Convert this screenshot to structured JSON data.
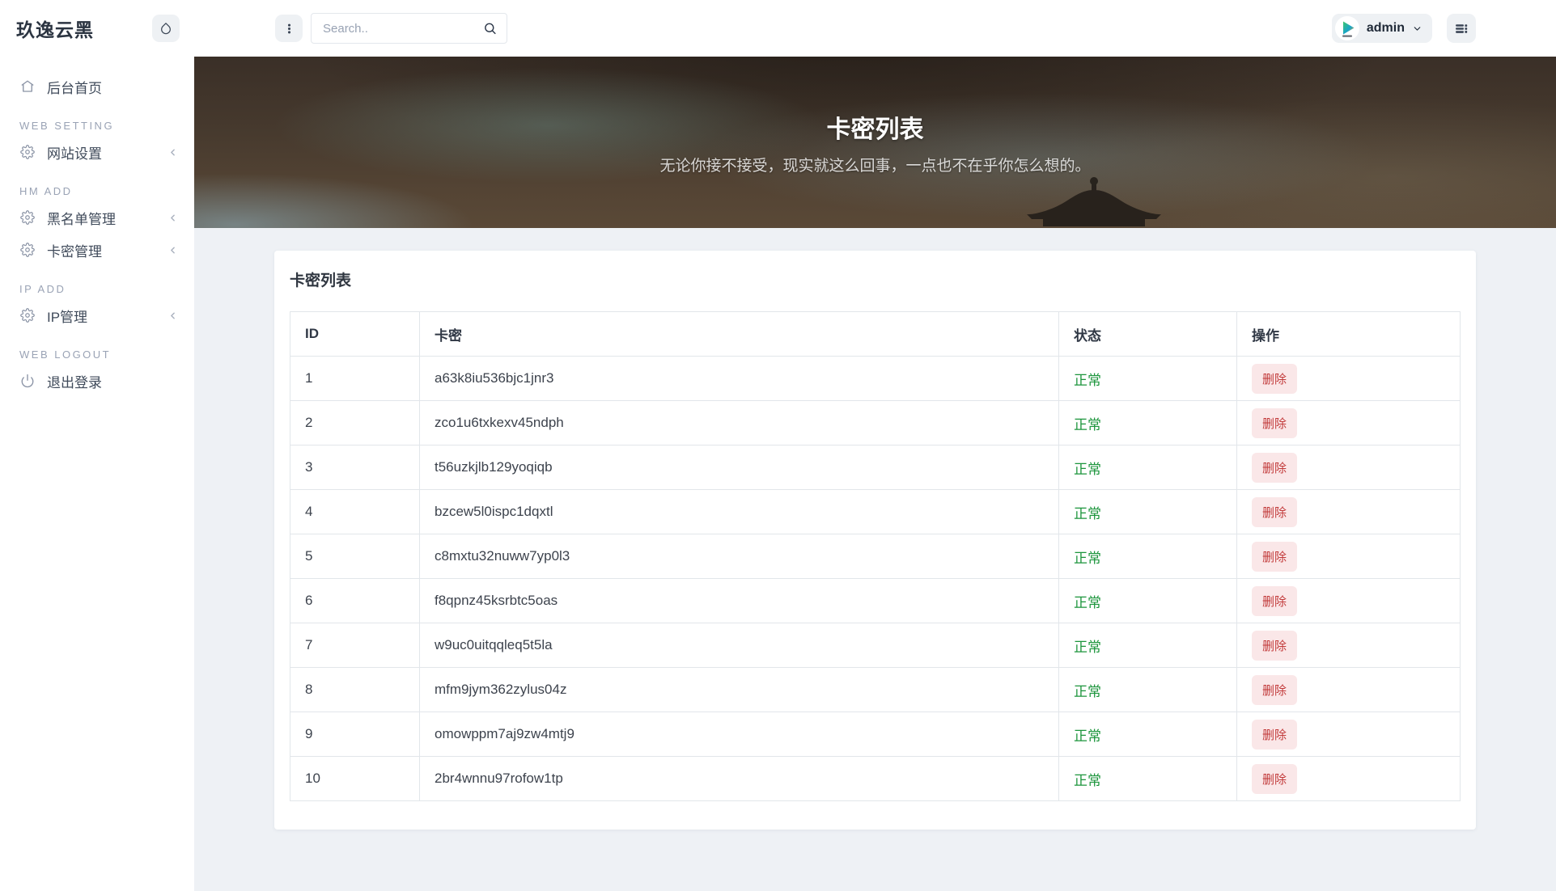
{
  "brand": "玖逸云黑",
  "topbar": {
    "search_placeholder": "Search..",
    "username": "admin"
  },
  "sidebar": {
    "items": [
      {
        "type": "link",
        "label": "后台首页",
        "icon": "home"
      },
      {
        "type": "section",
        "label": "WEB SETTING"
      },
      {
        "type": "link",
        "label": "网站设置",
        "icon": "gear",
        "expandable": true
      },
      {
        "type": "section",
        "label": "HM ADD"
      },
      {
        "type": "link",
        "label": "黑名单管理",
        "icon": "gear",
        "expandable": true
      },
      {
        "type": "link",
        "label": "卡密管理",
        "icon": "gear",
        "expandable": true
      },
      {
        "type": "section",
        "label": "IP ADD"
      },
      {
        "type": "link",
        "label": "IP管理",
        "icon": "gear",
        "expandable": true
      },
      {
        "type": "section",
        "label": "WEB LOGOUT"
      },
      {
        "type": "link",
        "label": "退出登录",
        "icon": "power"
      }
    ]
  },
  "hero": {
    "title": "卡密列表",
    "subtitle": "无论你接不接受，现实就这么回事，一点也不在乎你怎么想的。"
  },
  "panel": {
    "title": "卡密列表"
  },
  "table": {
    "headers": [
      "ID",
      "卡密",
      "状态",
      "操作"
    ],
    "rows": [
      {
        "id": "1",
        "key": "a63k8iu536bjc1jnr3",
        "status": "正常",
        "action": "删除"
      },
      {
        "id": "2",
        "key": "zco1u6txkexv45ndph",
        "status": "正常",
        "action": "删除"
      },
      {
        "id": "3",
        "key": "t56uzkjlb129yoqiqb",
        "status": "正常",
        "action": "删除"
      },
      {
        "id": "4",
        "key": "bzcew5l0ispc1dqxtl",
        "status": "正常",
        "action": "删除"
      },
      {
        "id": "5",
        "key": "c8mxtu32nuww7yp0l3",
        "status": "正常",
        "action": "删除"
      },
      {
        "id": "6",
        "key": "f8qpnz45ksrbtc5oas",
        "status": "正常",
        "action": "删除"
      },
      {
        "id": "7",
        "key": "w9uc0uitqqleq5t5la",
        "status": "正常",
        "action": "删除"
      },
      {
        "id": "8",
        "key": "mfm9jym362zylus04z",
        "status": "正常",
        "action": "删除"
      },
      {
        "id": "9",
        "key": "omowppm7aj9zw4mtj9",
        "status": "正常",
        "action": "删除"
      },
      {
        "id": "10",
        "key": "2br4wnnu97rofow1tp",
        "status": "正常",
        "action": "删除"
      }
    ]
  },
  "colors": {
    "status_green": "#1c953c",
    "danger_red": "#c23a3a",
    "danger_bg": "#fae7e8",
    "brand_dark": "#2b3441"
  }
}
